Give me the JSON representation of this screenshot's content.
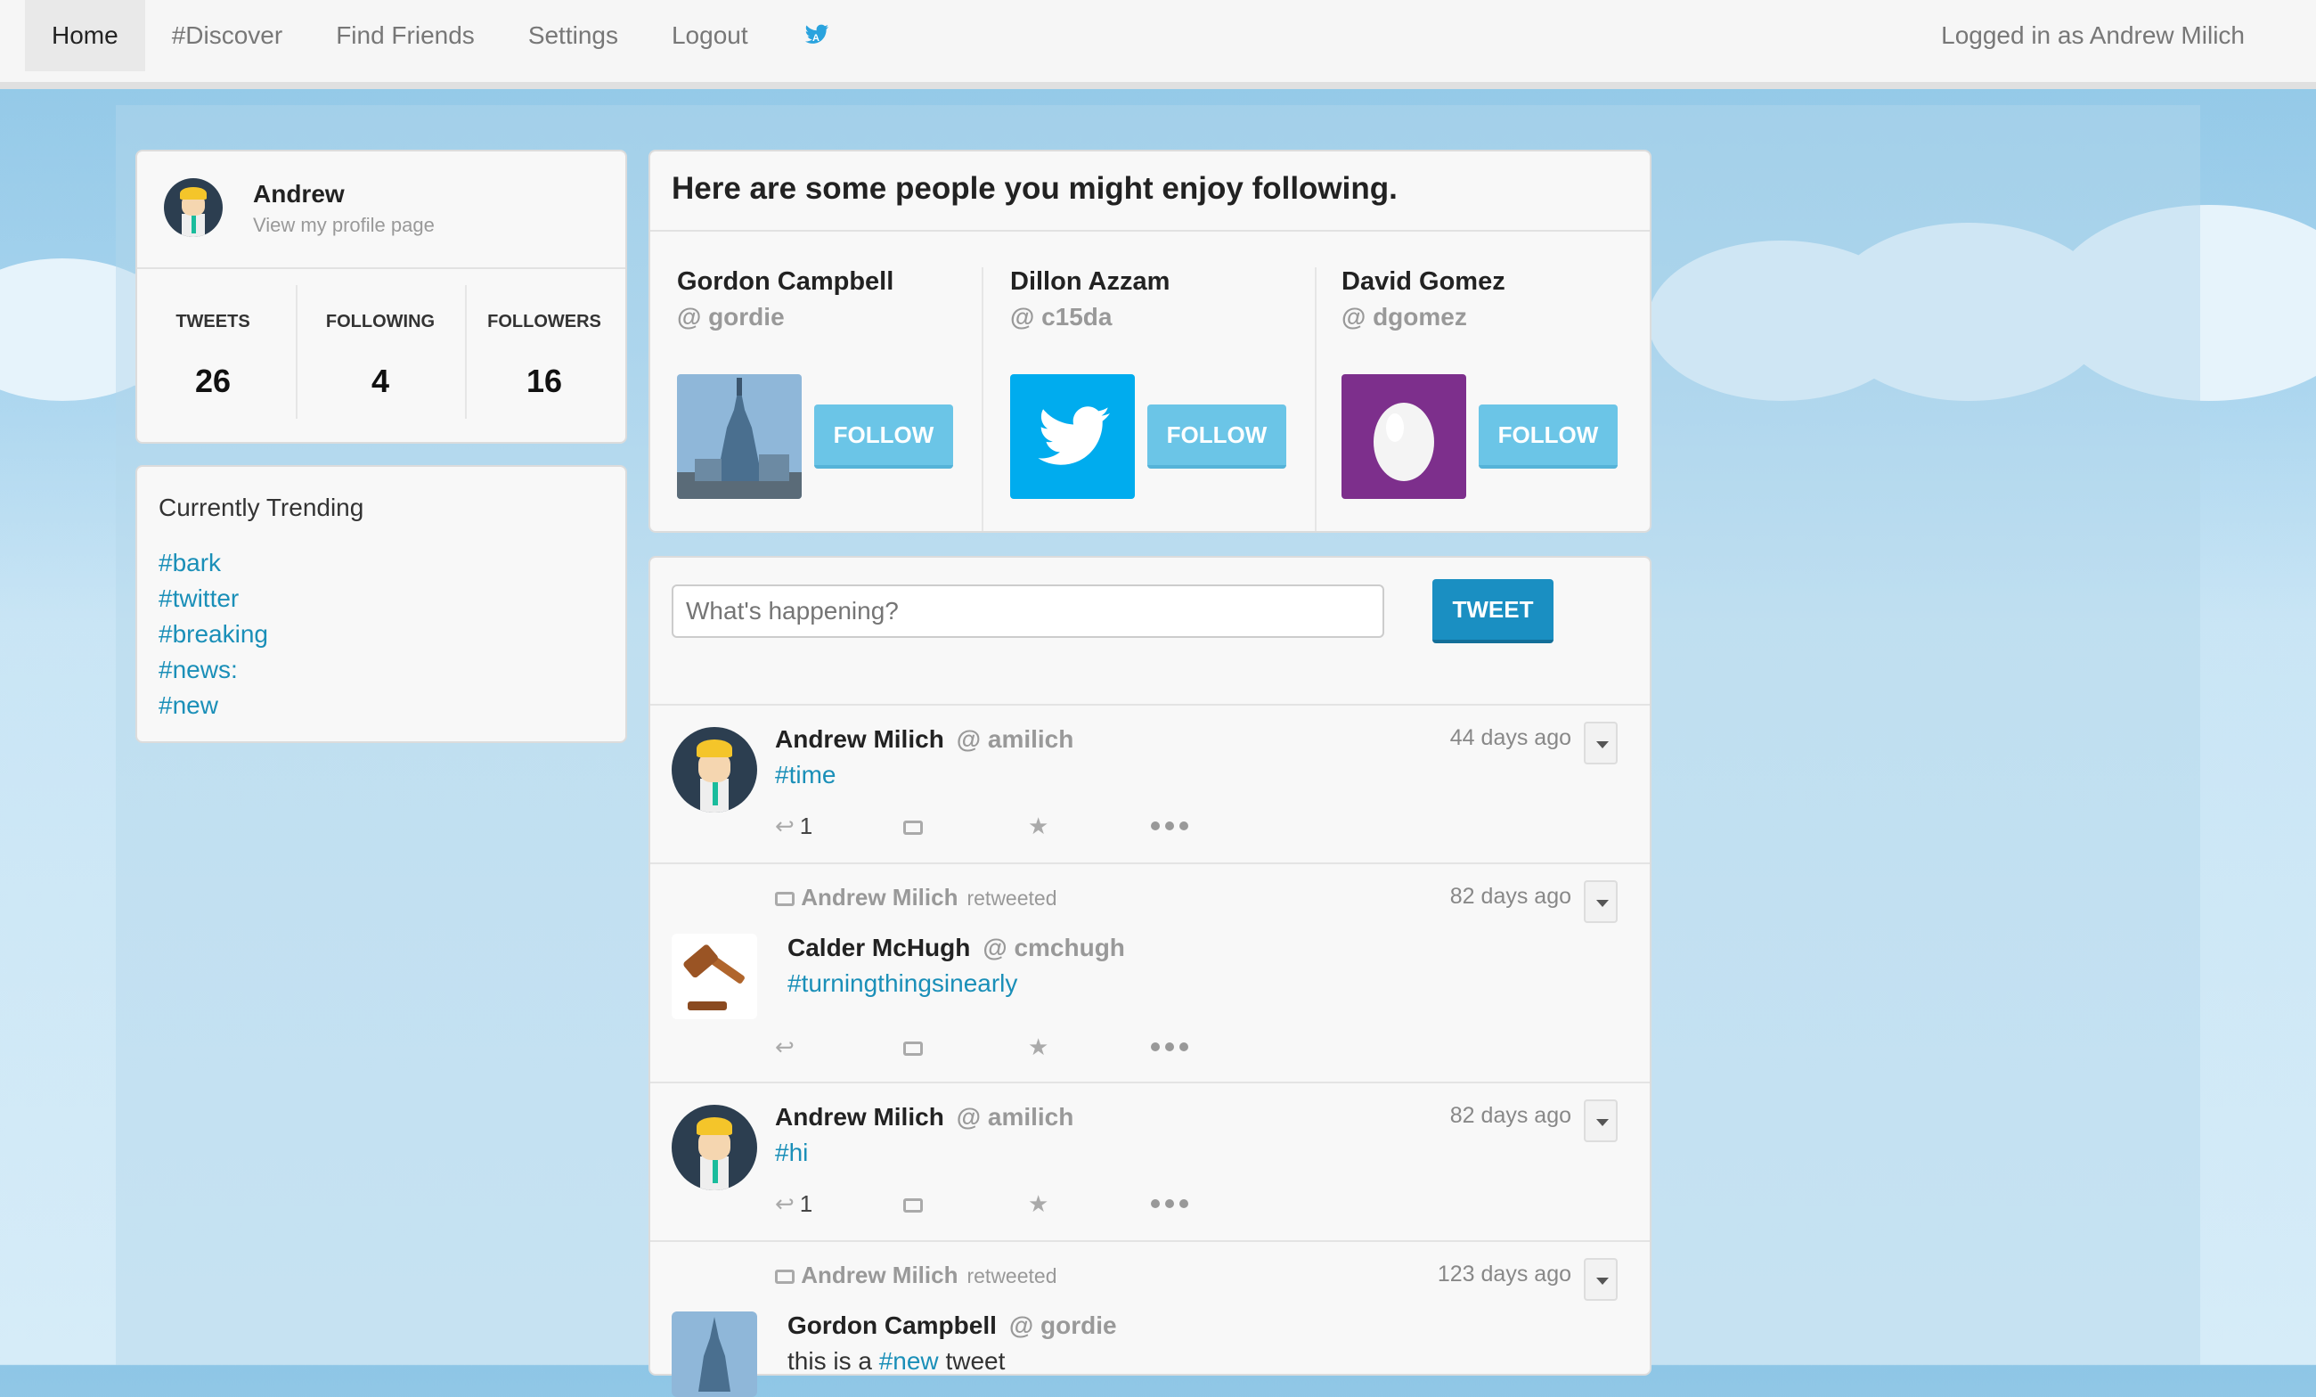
{
  "nav": {
    "items": [
      "Home",
      "#Discover",
      "Find Friends",
      "Settings",
      "Logout"
    ],
    "active": "Home",
    "logged_in_text": "Logged in as Andrew Milich"
  },
  "profile": {
    "name": "Andrew",
    "link": "View my profile page",
    "stats": [
      {
        "label": "TWEETS",
        "value": "26"
      },
      {
        "label": "FOLLOWING",
        "value": "4"
      },
      {
        "label": "FOLLOWERS",
        "value": "16"
      }
    ]
  },
  "trending": {
    "title": "Currently Trending",
    "tags": [
      "#bark",
      "#twitter",
      "#breaking",
      "#news:",
      "#new"
    ]
  },
  "suggestions": {
    "title": "Here are some people you might enjoy following.",
    "follow_label": "FOLLOW",
    "people": [
      {
        "name": "Gordon Campbell",
        "handle": "@ gordie"
      },
      {
        "name": "Dillon Azzam",
        "handle": "@ c15da"
      },
      {
        "name": "David Gomez",
        "handle": "@ dgomez"
      }
    ]
  },
  "compose": {
    "placeholder": "What's happening?",
    "tweet_label": "TWEET"
  },
  "tweets": [
    {
      "author": "Andrew Milich",
      "handle": "@ amilich",
      "text": "#time",
      "time": "44 days ago",
      "reply_count": "1"
    },
    {
      "retweeted_by": "Andrew Milich",
      "retweeted_label": "retweeted",
      "author": "Calder McHugh",
      "handle": "@ cmchugh",
      "text": "#turningthingsinearly",
      "time": "82 days ago"
    },
    {
      "author": "Andrew Milich",
      "handle": "@ amilich",
      "text": "#hi",
      "time": "82 days ago",
      "reply_count": "1"
    },
    {
      "retweeted_by": "Andrew Milich",
      "retweeted_label": "retweeted",
      "author": "Gordon Campbell",
      "handle": "@ gordie",
      "text_prefix": "this is a",
      "text_tag": "#new",
      "text_suffix": "tweet",
      "time": "123 days ago"
    }
  ],
  "colors": {
    "link": "#1a8fb8",
    "follow_button": "#6bc5e7",
    "tweet_button": "#1a8fc2",
    "twitter_blue": "#00acee",
    "egg_purple": "#7d2f8c"
  }
}
